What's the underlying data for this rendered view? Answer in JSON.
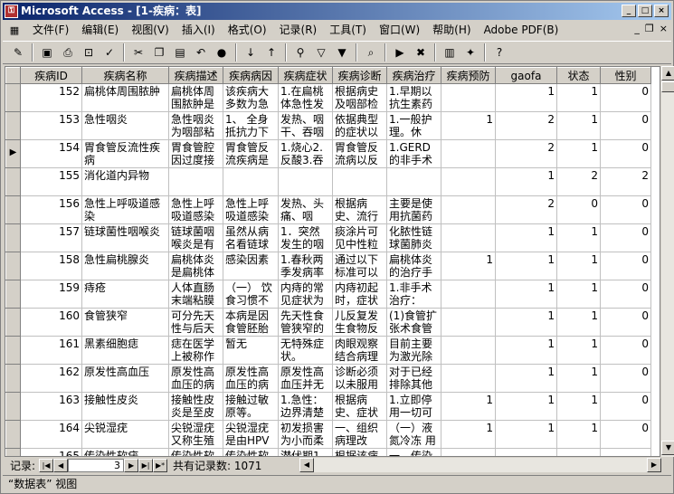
{
  "window": {
    "title": "Microsoft Access - [1-疾病：表]",
    "app_icon": "key-icon",
    "min": "_",
    "max": "□",
    "close": "×"
  },
  "menu": {
    "items": [
      "文件(F)",
      "编辑(E)",
      "视图(V)",
      "插入(I)",
      "格式(O)",
      "记录(R)",
      "工具(T)",
      "窗口(W)",
      "帮助(H)",
      "Adobe PDF(B)"
    ],
    "doc_min": "_",
    "doc_restore": "❐",
    "doc_close": "×"
  },
  "toolbar": {
    "icons": [
      "view-icon",
      "save-icon",
      "print-icon",
      "print-preview-icon",
      "spelling-icon",
      "cut-icon",
      "copy-icon",
      "paste-icon",
      "undo-icon",
      "hyperlink-icon",
      "sort-ascending-icon",
      "sort-descending-icon",
      "filter-by-selection-icon",
      "filter-by-form-icon",
      "apply-filter-icon",
      "find-icon",
      "new-record-icon",
      "delete-record-icon",
      "database-window-icon",
      "new-object-icon",
      "help-icon"
    ]
  },
  "table": {
    "columns": [
      "疾病ID",
      "疾病名称",
      "疾病描述",
      "疾病病因",
      "疾病症状",
      "疾病诊断",
      "疾病治疗",
      "疾病预防",
      "gaofa",
      "状态",
      "性别"
    ],
    "rows": [
      [
        "152",
        "扁桃体周围脓肿",
        "扁桃体周围脓肿是",
        "该疾病大多数为急",
        "1.在扁桃体急性发",
        "根据病史及咽部检",
        "1.早期以抗生素药",
        "",
        "1",
        "1",
        "0"
      ],
      [
        "153",
        "急性咽炎",
        "急性咽炎为咽部粘",
        "1、 全身抵抗力下",
        "发热、咽干、吞咽",
        "依据典型的症状以",
        "1.一般护理。休",
        "1",
        "2",
        "1",
        "0"
      ],
      [
        "154",
        "胃食管反流性疾病",
        "胃食管腔因过度接",
        "胃食管反流疾病是由",
        "1.烧心2.反酸3.吞",
        "胃食管反流病以反",
        "1.GERD的非手术治",
        "",
        "2",
        "1",
        "0"
      ],
      [
        "155",
        "消化道内异物",
        "",
        "",
        "",
        "",
        "",
        "",
        "1",
        "2",
        "2"
      ],
      [
        "156",
        "急性上呼吸道感染",
        "急性上呼吸道感染",
        "急性上呼吸道感染",
        "发热、头痛、咽",
        "根据病史、流行",
        "主要是使用抗菌药",
        "",
        "2",
        "0",
        "0"
      ],
      [
        "157",
        "链球菌性咽喉炎",
        "链球菌咽喉炎是有",
        "虽然从病名看链球",
        "1．突然发生的咽喉",
        "痰涂片可见中性粒",
        "化脓性链球菌肺炎",
        "",
        "1",
        "1",
        "0"
      ],
      [
        "158",
        "急性扁桃腺炎",
        "扁桃体炎是扁桃体",
        "感染因素",
        "1.春秋两季发病率",
        "通过以下标准可以",
        "扁桃体炎的治疗手",
        "1",
        "1",
        "1",
        "0"
      ],
      [
        "159",
        "痔疮",
        "人体直肠末端粘膜",
        "（一） 饮食习惯不",
        "内痔的常见症状为",
        "内痔初起时，症状",
        "1.非手术治疗：",
        "",
        "1",
        "1",
        "0"
      ],
      [
        "160",
        "食管狭窄",
        "可分先天性与后天",
        "本病是因食管胚胎",
        "先天性食管狭窄的",
        "儿反复发生食物反",
        "(1)食管扩张术食管",
        "",
        "1",
        "1",
        "0"
      ],
      [
        "161",
        "黑素细胞痣",
        "痣在医学上被称作",
        "暂无",
        "无特殊症状。",
        "肉眼观察结合病理",
        "目前主要为激光除",
        "",
        "1",
        "1",
        "0"
      ],
      [
        "162",
        "原发性高血压",
        "原发性高血压的病",
        "原发性高血压的病",
        "原发性高血压并无",
        "诊断必须以未服用",
        "对于已经排除其他",
        "",
        "1",
        "1",
        "0"
      ],
      [
        "163",
        "接触性皮炎",
        "接触性皮炎是至皮",
        "接触过敏原等。",
        "1.急性：边界清楚",
        "根据病史、症状",
        "1.立即停用一切可",
        "1",
        "1",
        "1",
        "0"
      ],
      [
        "164",
        "尖锐湿疣",
        "尖锐湿疣又称生殖",
        "尖锐湿疣是由HPV引",
        "初发损害为小而柔",
        "一、组织病理改",
        "（一）液氮冷冻 用",
        "1",
        "1",
        "1",
        "0"
      ],
      [
        "165",
        "传染性软疣",
        "传染性软",
        "传染性软",
        "潜伏期1周",
        "根据该病",
        "一、传染",
        "",
        "",
        "",
        ""
      ]
    ],
    "current_row_index": 2,
    "current_marker": "▶"
  },
  "nav": {
    "label": "记录:",
    "current": "3",
    "total_label": "共有记录数: 1071",
    "first": "|◀",
    "prev": "◀",
    "next": "▶",
    "last": "▶|",
    "new": "▶*"
  },
  "status": {
    "text": "“数据表” 视图"
  }
}
